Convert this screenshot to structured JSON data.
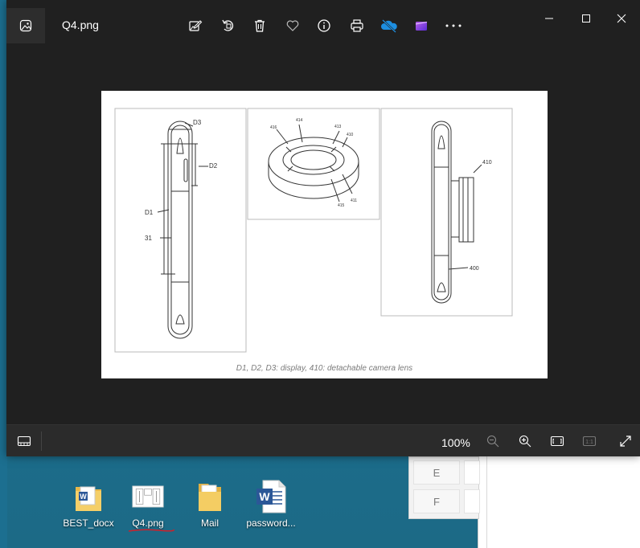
{
  "window": {
    "title": "Q4.png",
    "toolbar": {
      "edit_icon": "edit-image-icon",
      "rotate_icon": "rotate-icon",
      "delete_icon": "delete-icon",
      "favorite_icon": "heart-icon",
      "info_icon": "info-icon",
      "print_icon": "print-icon",
      "onedrive_icon": "onedrive-icon",
      "video_editor_icon": "video-editor-icon",
      "more_icon": "more-icon"
    },
    "controls": {
      "minimize": "minimize-icon",
      "maximize": "maximize-icon",
      "close": "close-icon"
    }
  },
  "image": {
    "caption": "D1, D2, D3: display, 410: detachable camera lens",
    "figure_labels": {
      "d3": "D3",
      "d2": "D2",
      "d1": "D1",
      "n31": "31",
      "n414": "414",
      "n416": "416",
      "n413": "413",
      "n410_top": "410",
      "n411": "411",
      "n415": "415",
      "n410_right": "410",
      "n400": "400"
    }
  },
  "bottom_bar": {
    "zoom_percent": "100%"
  },
  "desktop": {
    "icons": [
      {
        "label": "BEST_docx",
        "type": "word-folder-icon"
      },
      {
        "label": "Q4.png",
        "type": "image-file-icon"
      },
      {
        "label": "Mail",
        "type": "folder-icon"
      },
      {
        "label": "password...",
        "type": "word-document-icon"
      }
    ],
    "calculator_keys": [
      "E",
      "F"
    ]
  },
  "colors": {
    "window_bg": "#202020",
    "bottombar_bg": "#2b2b2b",
    "desktop_bg": "#1b6d8f",
    "underline": "#d0202a"
  }
}
